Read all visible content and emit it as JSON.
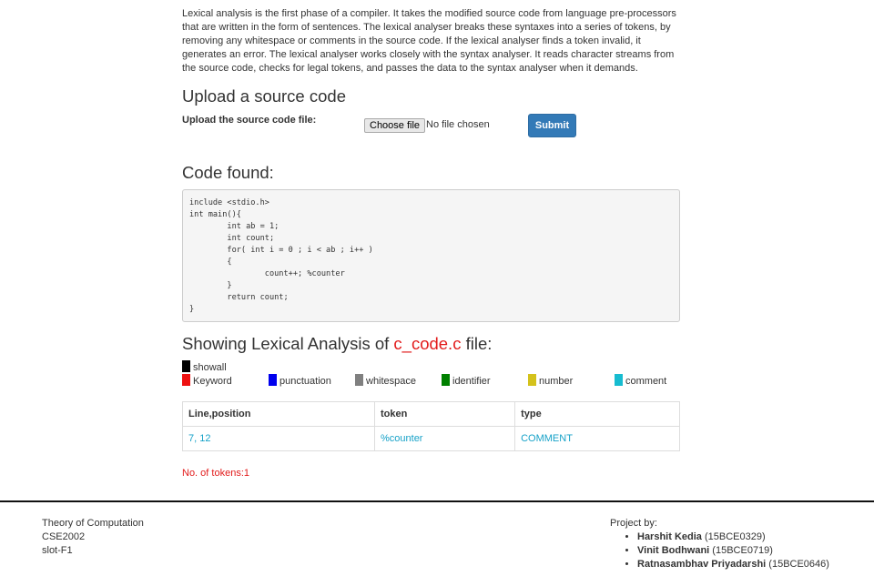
{
  "intro": "Lexical analysis is the first phase of a compiler. It takes the modified source code from language pre-processors that are written in the form of sentences. The lexical analyser breaks these syntaxes into a series of tokens, by removing any whitespace or comments in the source code. If the lexical analyser finds a token invalid, it generates an error. The lexical analyser works closely with the syntax analyser. It reads character streams from the source code, checks for legal tokens, and passes the data to the syntax analyser when it demands.",
  "upload": {
    "title": "Upload a source code",
    "label": "Upload the source code file:",
    "choose_label": "Choose file",
    "no_file": "No file chosen",
    "submit_label": "Submit"
  },
  "code": {
    "title": "Code found:",
    "content": "include <stdio.h>\nint main(){\n        int ab = 1;\n        int count;\n        for( int i = 0 ; i < ab ; i++ )\n        {\n                count++; %counter\n        }\n        return count;\n}"
  },
  "analysis": {
    "title_prefix": "Showing Lexical Analysis of ",
    "filename": "c_code.c",
    "title_suffix": " file:",
    "showall": {
      "label": "showall",
      "color": "#000000"
    },
    "legend": [
      {
        "label": "Keyword",
        "color": "#ee1111"
      },
      {
        "label": "punctuation",
        "color": "#0000ee"
      },
      {
        "label": "whitespace",
        "color": "#808080"
      },
      {
        "label": "identifier",
        "color": "#008000"
      },
      {
        "label": "number",
        "color": "#d4c21c"
      },
      {
        "label": "comment",
        "color": "#17bcd0"
      }
    ],
    "table": {
      "headers": [
        "Line,position",
        "token",
        "type"
      ],
      "rows": [
        [
          "7, 12",
          "%counter",
          "COMMENT"
        ]
      ]
    },
    "count_text": "No. of tokens:1"
  },
  "footer": {
    "left": [
      "Theory of Computation",
      "CSE2002",
      "slot-F1"
    ],
    "project_by": "Project by:",
    "members": [
      {
        "name": "Harshit Kedia",
        "id": " (15BCE0329)"
      },
      {
        "name": "Vinit Bodhwani",
        "id": " (15BCE0719)"
      },
      {
        "name": "Ratnasambhav Priyadarshi",
        "id": " (15BCE0646)"
      }
    ]
  }
}
